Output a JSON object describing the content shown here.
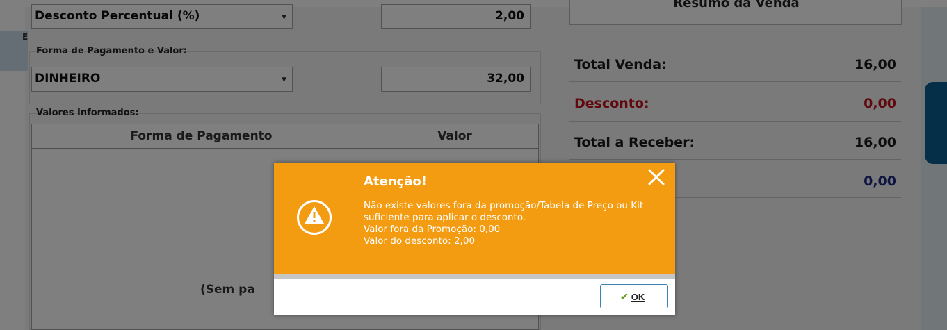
{
  "pdv": {
    "discount_type": {
      "value": "Desconto Percentual (%)",
      "amount": "2,00"
    },
    "payment": {
      "group_label": "Forma de Pagamento e Valor:",
      "method": "DINHEIRO",
      "amount": "32,00"
    },
    "values_group": {
      "label": "Valores Informados:",
      "columns": [
        "Forma de Pagamento",
        "Valor"
      ],
      "empty_message": "(Sem pa"
    },
    "left_tab_letter": "E"
  },
  "summary": {
    "title": "Resumo da Venda",
    "total_sale_label": "Total Venda:",
    "total_sale_value": "16,00",
    "discount_label": "Desconto:",
    "discount_value": "0,00",
    "total_receive_label": "Total a Receber:",
    "total_receive_value": "16,00",
    "change_value": "0,00"
  },
  "dialog": {
    "title": "Atenção!",
    "message": "Não existe valores fora da promoção/Tabela de Preço ou Kit\nsuficiente para aplicar o desconto.\nValor fora da Promoção: 0,00\nValor do desconto: 2,00",
    "ok_label": "OK",
    "icons": {
      "warning": "warning-triangle-icon",
      "close": "close-icon",
      "ok": "checkmark-icon"
    },
    "colors": {
      "header": "#f39c12",
      "ok_border": "#3c7fb1"
    }
  },
  "colors": {
    "discount_red": "#c0101a",
    "change_blue": "#1a2a80"
  }
}
